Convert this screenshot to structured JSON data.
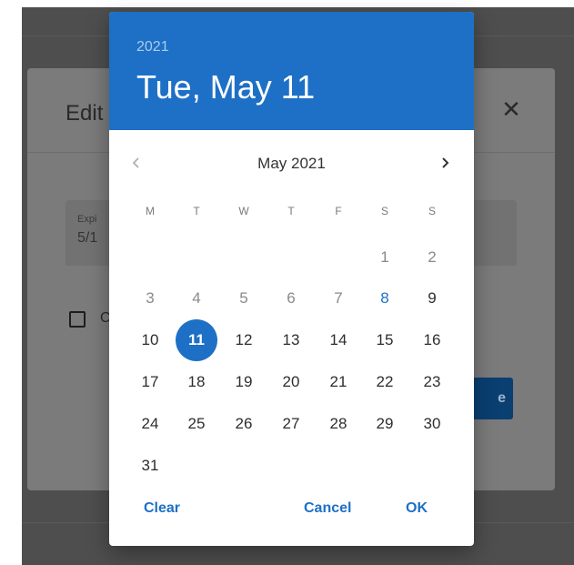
{
  "edit_dialog": {
    "title": "Edit",
    "field_label": "Expi",
    "field_value": "5/1",
    "checkbox_label": "C",
    "save_label": "e"
  },
  "picker": {
    "year": "2021",
    "selected_date": "Tue, May 11",
    "month_label": "May 2021",
    "weekdays": [
      "M",
      "T",
      "W",
      "T",
      "F",
      "S",
      "S"
    ],
    "weeks": [
      [
        "",
        "",
        "",
        "",
        "",
        "1",
        "2"
      ],
      [
        "3",
        "4",
        "5",
        "6",
        "7",
        "8",
        "9"
      ],
      [
        "10",
        "11",
        "12",
        "13",
        "14",
        "15",
        "16"
      ],
      [
        "17",
        "18",
        "19",
        "20",
        "21",
        "22",
        "23"
      ],
      [
        "24",
        "25",
        "26",
        "27",
        "28",
        "29",
        "30"
      ],
      [
        "31",
        "",
        "",
        "",
        "",
        "",
        ""
      ]
    ],
    "selected_day": "11",
    "today_day": "8",
    "clear_label": "Clear",
    "cancel_label": "Cancel",
    "ok_label": "OK"
  },
  "colors": {
    "accent": "#1d70c6",
    "header_year": "#a9cbef"
  }
}
